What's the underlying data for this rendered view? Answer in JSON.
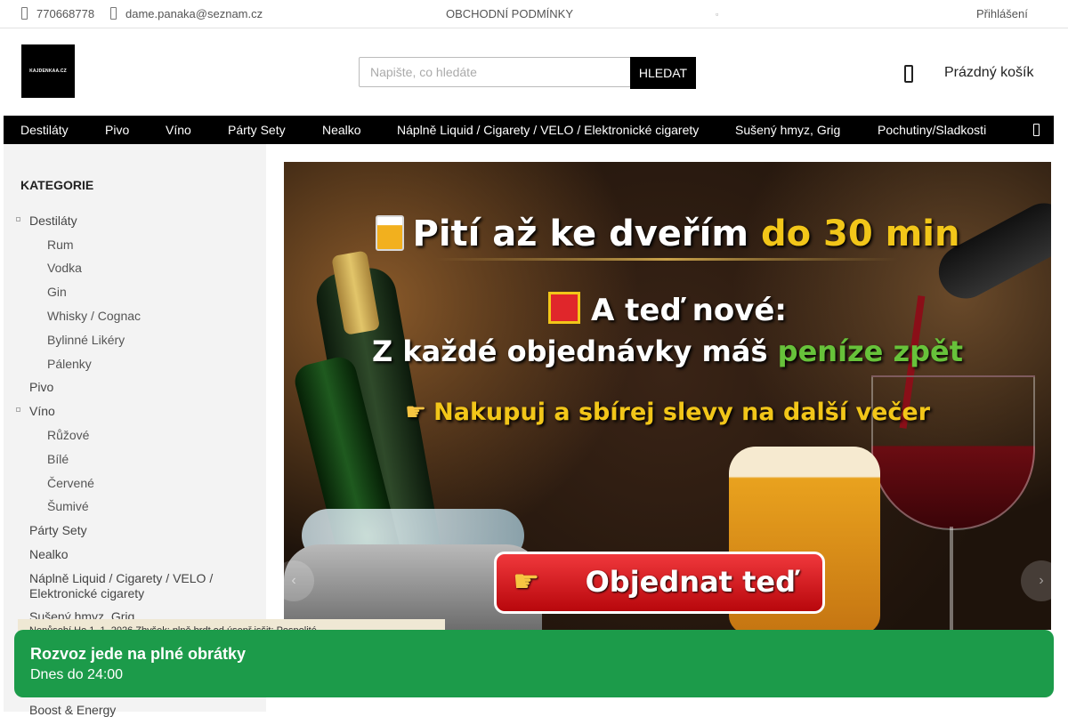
{
  "topbar": {
    "phone": "770668778",
    "email": "dame.panaka@seznam.cz",
    "terms": "OBCHODNÍ PODMÍNKY",
    "login": "Přihlášení"
  },
  "header": {
    "logo_text": "KAJDENKAA.CZ",
    "search_placeholder": "Napište, co hledáte",
    "search_button": "HLEDAT",
    "cart_label": "Prázdný košík"
  },
  "nav": {
    "items": [
      "Destiláty",
      "Pivo",
      "Víno",
      "Párty Sety",
      "Nealko",
      "Náplně Liquid / Cigarety / VELO / Elektronické cigarety",
      "Sušený hmyz, Grig",
      "Pochutiny/Sladkosti"
    ],
    "menu_icon": "hamburger-icon"
  },
  "sidebar": {
    "heading": "KATEGORIE",
    "categories": [
      {
        "label": "Destiláty"
      },
      {
        "label": "Rum"
      },
      {
        "label": "Vodka"
      },
      {
        "label": "Gin"
      },
      {
        "label": "Whisky / Cognac"
      },
      {
        "label": "Bylinné Likéry"
      },
      {
        "label": "Pálenky"
      },
      {
        "label": "Pivo"
      },
      {
        "label": "Víno"
      },
      {
        "label": "Růžové"
      },
      {
        "label": "Bílé"
      },
      {
        "label": "Červené"
      },
      {
        "label": "Šumivé"
      },
      {
        "label": "Párty Sety"
      },
      {
        "label": "Nealko"
      },
      {
        "label": "Náplně Liquid / Cigarety / VELO /"
      },
      {
        "label": "Elektronické cigarety"
      },
      {
        "label": "Sušený hmyz, Grig"
      },
      {
        "label": "Boost & Energy"
      }
    ]
  },
  "banner": {
    "line1_a": "Pití až ke dveřím ",
    "line1_b": "do 30 min",
    "line2": "A teď nové:",
    "line3_a": "Z každé objednávky máš ",
    "line3_b": "peníze zpět",
    "line4": "Nakupuj a sbírej slevy na další večer",
    "cta": "Objednat teď",
    "prev_icon": "chevron-left-icon",
    "next_icon": "chevron-right-icon"
  },
  "cookie": {
    "text": "Nepůsobí Ho 1. 1. 2026 Zbyšek; plně brdt od úsepř jsšit; Pospolité …"
  },
  "toast": {
    "title": "Rozvoz jede na plné obrátky",
    "subtitle": "Dnes do 24:00"
  }
}
